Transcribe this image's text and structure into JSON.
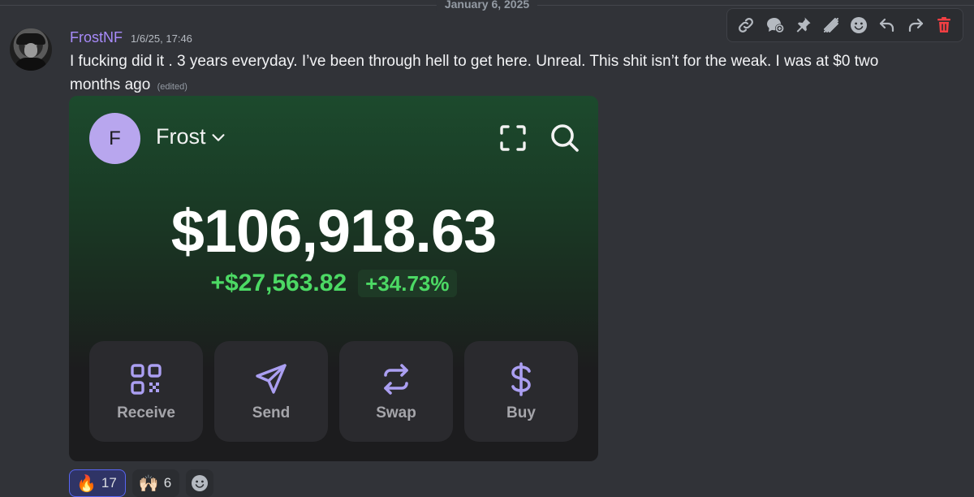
{
  "divider": {
    "date": "January 6, 2025"
  },
  "message": {
    "username": "FrostNF",
    "timestamp": "1/6/25, 17:46",
    "text": "I fucking did it . 3 years everyday. I’ve been through hell to get here. Unreal. This shit isn’t for the weak. I was at $0 two months ago",
    "edited_label": "(edited)"
  },
  "action_bar": {
    "icons": [
      "link-icon",
      "create-thread-icon",
      "pin-icon",
      "super-reaction-icon",
      "add-reaction-icon",
      "reply-icon",
      "forward-icon",
      "delete-icon"
    ]
  },
  "wallet": {
    "avatar_letter": "F",
    "account_name": "Frost",
    "balance": "$106,918.63",
    "change_amount": "+$27,563.82",
    "change_percent": "+34.73%",
    "actions": [
      {
        "label": "Receive",
        "icon": "qr-code-icon"
      },
      {
        "label": "Send",
        "icon": "send-icon"
      },
      {
        "label": "Swap",
        "icon": "swap-icon"
      },
      {
        "label": "Buy",
        "icon": "dollar-icon"
      }
    ],
    "colors": {
      "accent": "#ab9ff2",
      "positive": "#4cd964"
    }
  },
  "reactions": [
    {
      "emoji": "🔥",
      "count": "17",
      "selected": true
    },
    {
      "emoji": "🙌🏻",
      "count": "6",
      "selected": false
    }
  ],
  "colors": {
    "username": "#a88bfa",
    "background": "#313338",
    "delete": "#f23f43"
  }
}
